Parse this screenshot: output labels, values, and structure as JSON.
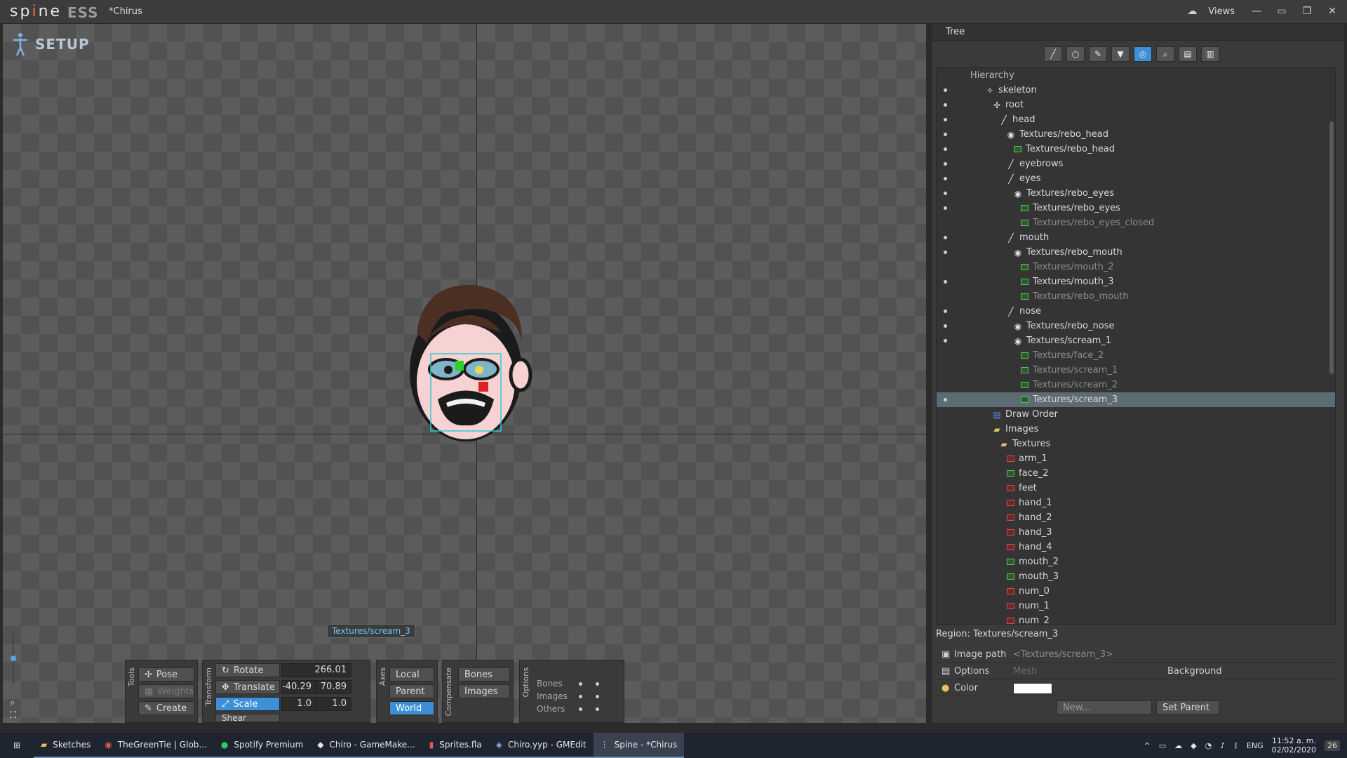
{
  "app": {
    "logo": "spine",
    "edition": "ESS",
    "project_title": "*Chirus",
    "views_label": "Views"
  },
  "viewport": {
    "mode_label": "SETUP",
    "tooltip": "Textures/scream_3"
  },
  "tools": {
    "section_label": "Tools",
    "pose": "Pose",
    "weights": "Weights",
    "create": "Create"
  },
  "transform": {
    "section_label": "Transform",
    "rotate_label": "Rotate",
    "rotate_value": "266.01",
    "translate_label": "Translate",
    "translate_x": "-40.29",
    "translate_y": "70.89",
    "scale_label": "Scale",
    "scale_x": "1.0",
    "scale_y": "1.0",
    "shear_label": "Shear"
  },
  "axes": {
    "section_label": "Axes",
    "local": "Local",
    "parent": "Parent",
    "world": "World"
  },
  "compensate": {
    "section_label": "Compensate",
    "bones": "Bones",
    "images": "Images"
  },
  "options": {
    "section_label": "Options",
    "rows": [
      "Bones",
      "Images",
      "Others"
    ]
  },
  "panel": {
    "title": "Tree",
    "hierarchy_label": "Hierarchy",
    "tree": [
      {
        "label": "skeleton",
        "icon": "skeleton-icon"
      },
      {
        "label": "root",
        "icon": "root-bone-icon"
      },
      {
        "label": "head",
        "icon": "bone-icon"
      },
      {
        "label": "Textures/rebo_head",
        "icon": "slot-icon"
      },
      {
        "label": "Textures/rebo_head",
        "icon": "image-icon"
      },
      {
        "label": "eyebrows",
        "icon": "bone-icon"
      },
      {
        "label": "eyes",
        "icon": "bone-icon"
      },
      {
        "label": "Textures/rebo_eyes",
        "icon": "slot-icon"
      },
      {
        "label": "Textures/rebo_eyes",
        "icon": "image-icon"
      },
      {
        "label": "Textures/rebo_eyes_closed",
        "icon": "image-icon"
      },
      {
        "label": "mouth",
        "icon": "bone-icon"
      },
      {
        "label": "Textures/rebo_mouth",
        "icon": "slot-icon"
      },
      {
        "label": "Textures/mouth_2",
        "icon": "image-icon"
      },
      {
        "label": "Textures/mouth_3",
        "icon": "image-icon"
      },
      {
        "label": "Textures/rebo_mouth",
        "icon": "image-icon"
      },
      {
        "label": "nose",
        "icon": "bone-icon"
      },
      {
        "label": "Textures/rebo_nose",
        "icon": "slot-icon"
      },
      {
        "label": "Textures/scream_1",
        "icon": "slot-icon"
      },
      {
        "label": "Textures/face_2",
        "icon": "image-icon"
      },
      {
        "label": "Textures/scream_1",
        "icon": "image-icon"
      },
      {
        "label": "Textures/scream_2",
        "icon": "image-icon"
      },
      {
        "label": "Textures/scream_3",
        "icon": "image-icon"
      },
      {
        "label": "Draw Order",
        "icon": "draw-order-icon"
      },
      {
        "label": "Images",
        "icon": "folder-icon"
      },
      {
        "label": "Textures",
        "icon": "folder-icon"
      },
      {
        "label": "arm_1",
        "icon": "image-red-icon"
      },
      {
        "label": "face_2",
        "icon": "image-icon"
      },
      {
        "label": "feet",
        "icon": "image-red-icon"
      },
      {
        "label": "hand_1",
        "icon": "image-red-icon"
      },
      {
        "label": "hand_2",
        "icon": "image-red-icon"
      },
      {
        "label": "hand_3",
        "icon": "image-red-icon"
      },
      {
        "label": "hand_4",
        "icon": "image-red-icon"
      },
      {
        "label": "mouth_2",
        "icon": "image-icon"
      },
      {
        "label": "mouth_3",
        "icon": "image-icon"
      },
      {
        "label": "num_0",
        "icon": "image-red-icon"
      },
      {
        "label": "num_1",
        "icon": "image-red-icon"
      },
      {
        "label": "num_2",
        "icon": "image-red-icon"
      }
    ],
    "region_label": "Region: Textures/scream_3",
    "image_path_label": "Image path",
    "image_path_value": "<Textures/scream_3>",
    "options_label": "Options",
    "mesh_label": "Mesh",
    "background_label": "Background",
    "color_label": "Color",
    "new_button": "New...",
    "set_parent_button": "Set Parent"
  },
  "taskbar": {
    "items": [
      "Sketches",
      "TheGreenTie | Glob...",
      "Spotify Premium",
      "Chiro - GameMake...",
      "Sprites.fla",
      "Chiro.yyp - GMEdit",
      "Spine - *Chirus"
    ],
    "lang": "ENG",
    "time": "11:52 a. m.",
    "date": "02/02/2020",
    "notif_count": "26"
  },
  "colors": {
    "accent": "#3d8fd8",
    "selected_row": "#5d6b73"
  }
}
